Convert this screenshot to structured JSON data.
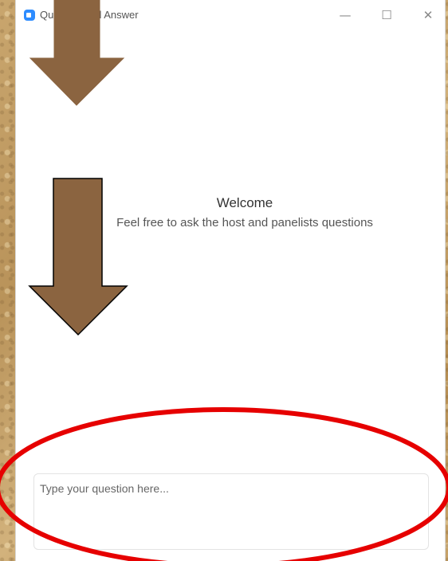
{
  "window": {
    "title": "Question and Answer",
    "controls": {
      "minimize_icon": "minimize-icon",
      "maximize_icon": "maximize-icon",
      "close_icon": "close-icon"
    }
  },
  "welcome": {
    "heading": "Welcome",
    "subtitle": "Feel free to ask the host and panelists questions"
  },
  "question_input": {
    "placeholder": "Type your question here..."
  },
  "annotations": {
    "arrow_color": "#8b6440",
    "ellipse_color": "#e60000"
  },
  "colors": {
    "accent": "#2d8cff"
  }
}
